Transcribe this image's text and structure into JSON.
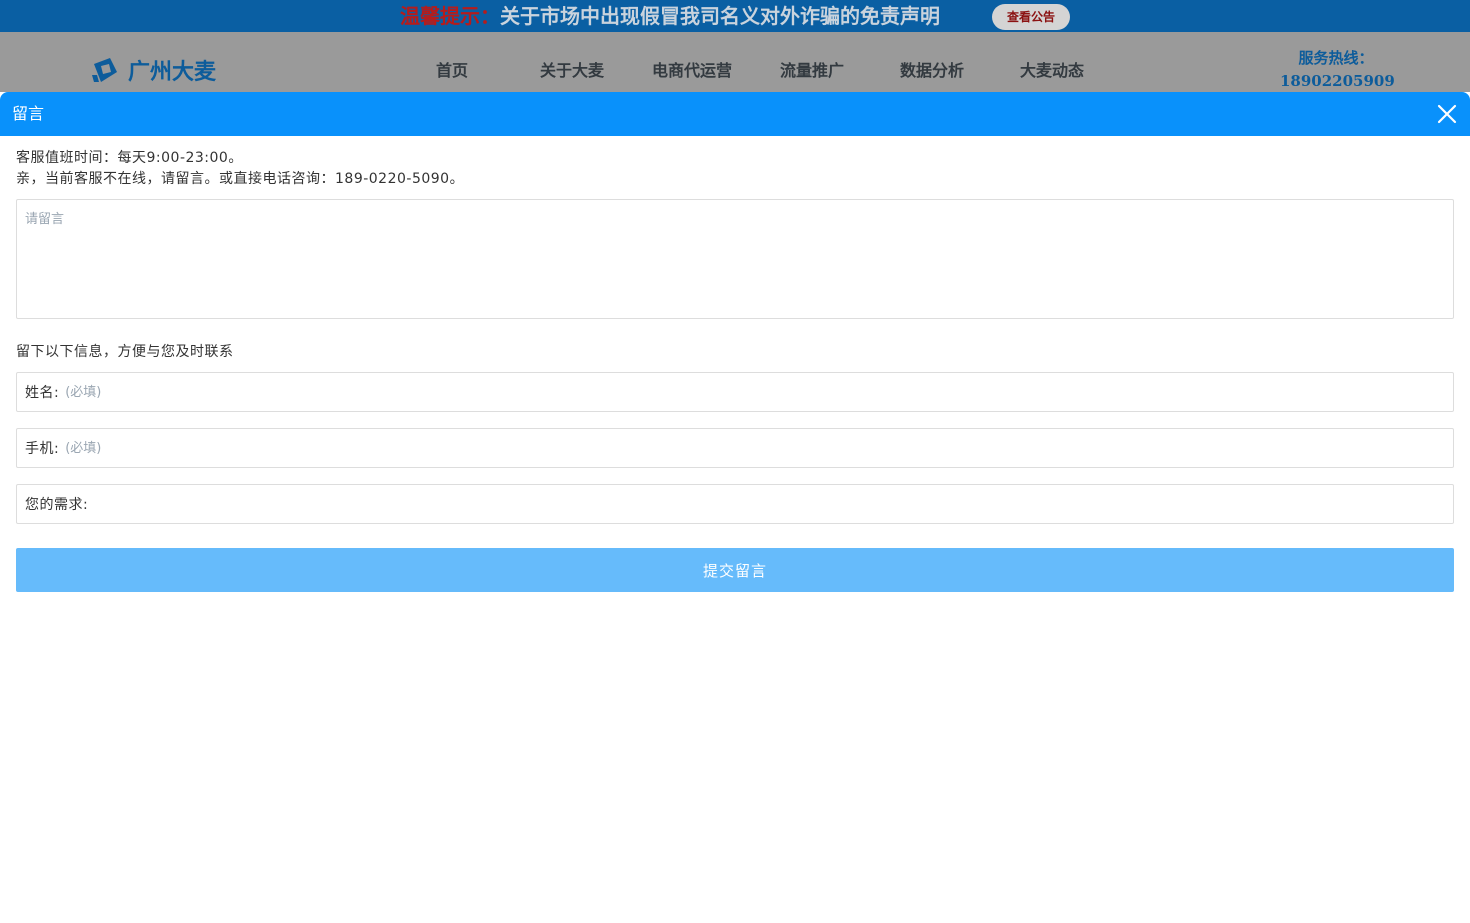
{
  "notice": {
    "prefix": "温馨提示：",
    "text": "关于市场中出现假冒我司名义对外诈骗的免责声明",
    "button_label": "查看公告"
  },
  "header": {
    "logo_text": "广州大麦",
    "nav": [
      "首页",
      "关于大麦",
      "电商代运营",
      "流量推广",
      "数据分析",
      "大麦动态"
    ],
    "hotline_label": "服务热线：",
    "hotline_number": "18902205909"
  },
  "modal": {
    "title": "留言",
    "service_hours": "客服值班时间：每天9:00-23:00。",
    "offline_notice": "亲，当前客服不在线，请留言。或直接电话咨询：189-0220-5090。",
    "message_placeholder": "请留言",
    "contact_prompt": "留下以下信息，方便与您及时联系",
    "fields": [
      {
        "label": "姓名:",
        "placeholder": "(必填)",
        "value": ""
      },
      {
        "label": "手机:",
        "placeholder": "(必填)",
        "value": ""
      },
      {
        "label": "您的需求:",
        "placeholder": "",
        "value": ""
      }
    ],
    "submit_label": "提交留言"
  },
  "colors": {
    "modal_header": "#0991fb",
    "submit_button": "#66bbfb",
    "notice_bar": "#0a5fa3",
    "header_dimmed": "#9a9a9a"
  }
}
